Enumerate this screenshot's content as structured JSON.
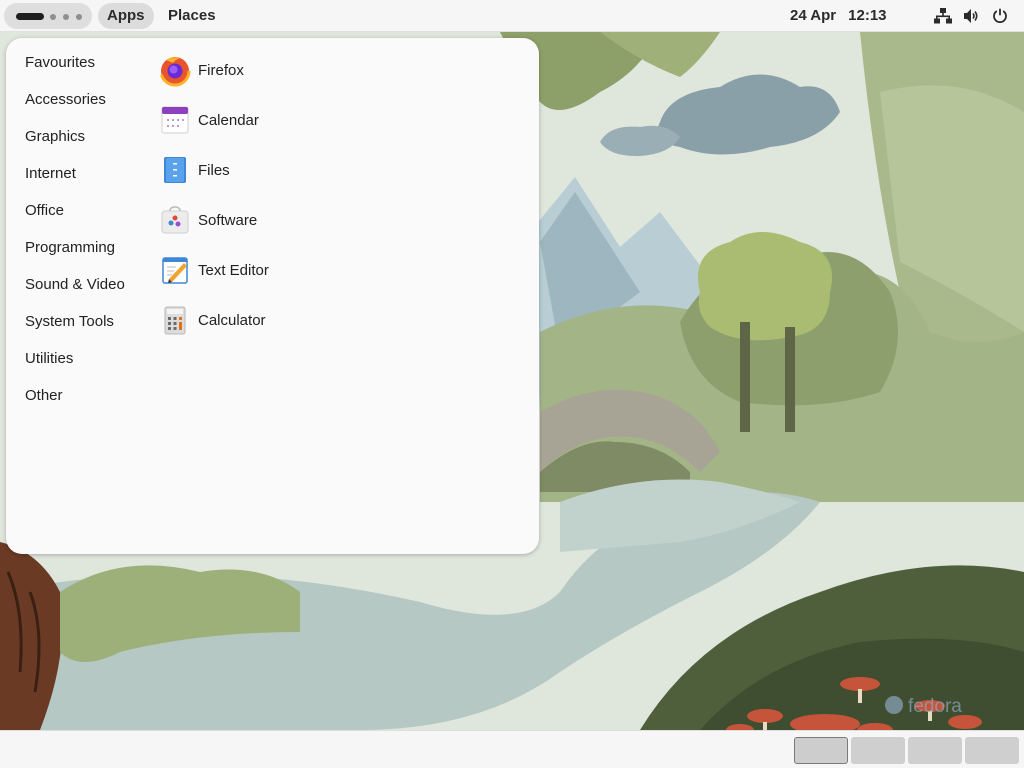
{
  "topbar": {
    "activities_icon": "activities-indicator",
    "apps_label": "Apps",
    "places_label": "Places",
    "date": "24 Apr",
    "time": "12:13",
    "tray": [
      "network-icon",
      "volume-icon",
      "power-icon"
    ]
  },
  "apps_menu": {
    "categories": [
      {
        "label": "Favourites"
      },
      {
        "label": "Accessories"
      },
      {
        "label": "Graphics"
      },
      {
        "label": "Internet"
      },
      {
        "label": "Office"
      },
      {
        "label": "Programming"
      },
      {
        "label": "Sound & Video"
      },
      {
        "label": "System Tools"
      },
      {
        "label": "Utilities"
      },
      {
        "label": "Other"
      }
    ],
    "apps": [
      {
        "label": "Firefox",
        "icon": "firefox-icon"
      },
      {
        "label": "Calendar",
        "icon": "calendar-icon"
      },
      {
        "label": "Files",
        "icon": "files-icon"
      },
      {
        "label": "Software",
        "icon": "software-icon"
      },
      {
        "label": "Text Editor",
        "icon": "text-editor-icon"
      },
      {
        "label": "Calculator",
        "icon": "calculator-icon"
      }
    ]
  },
  "wallpaper": {
    "watermark": "fedora"
  },
  "bottombar": {
    "workspaces": 4,
    "active_workspace": 1
  },
  "colors": {
    "panel": "#f6f6f6",
    "menu_bg": "#fafafa",
    "text": "#222222"
  }
}
